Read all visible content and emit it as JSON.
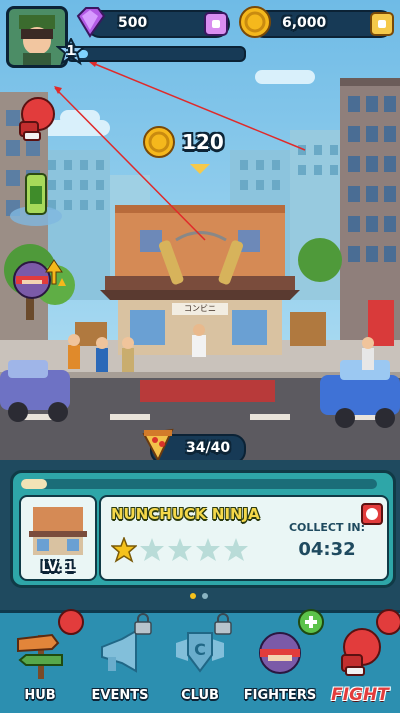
{
  "hud": {
    "gems": "500",
    "coins": "6,000",
    "level": "1"
  },
  "reward": {
    "coin_amount": "120"
  },
  "shop_sign": "コンビニ",
  "pizza_progress": "34/40",
  "building_card": {
    "name": "NUNCHUCK NINJA",
    "level_label": "LV. 1",
    "collect_label": "COLLECT IN:",
    "collect_time": "04:32",
    "stars_filled": 1,
    "stars_total": 5
  },
  "nav": {
    "hub": "HUB",
    "events": "EVENTS",
    "club": "CLUB",
    "fighters": "FIGHTERS",
    "fight": "FIGHT"
  },
  "colors": {
    "accent_gold": "#f5b81c",
    "panel_teal": "#2ea6a8",
    "fight_red": "#e23c3c"
  }
}
